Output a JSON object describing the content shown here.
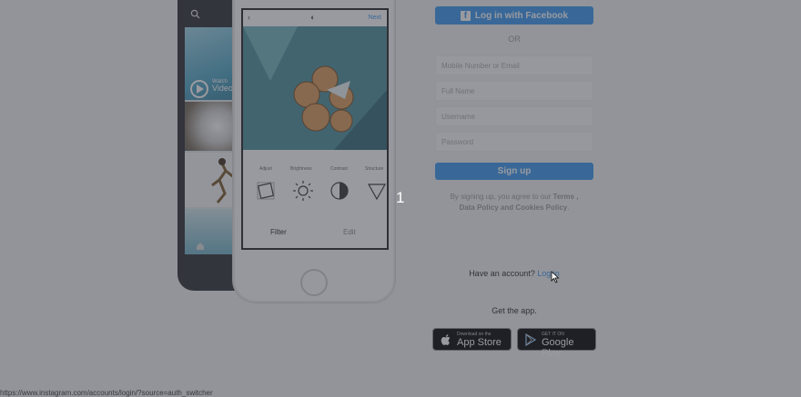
{
  "phone_back": {
    "video_text_1": "Watch",
    "video_text_2": "Video"
  },
  "phone_front": {
    "next_label": "Next",
    "tabs": [
      "Adjust",
      "Brightness",
      "Contrast",
      "Structure"
    ],
    "bottom_left": "Filter",
    "bottom_right": "Edit"
  },
  "step_number": "1",
  "form": {
    "facebook_label": "Log in with Facebook",
    "or_label": "OR",
    "mobile_placeholder": "Mobile Number or Email",
    "fullname_placeholder": "Full Name",
    "username_placeholder": "Username",
    "password_placeholder": "Password",
    "signup_label": "Sign up",
    "terms_prefix": "By signing up, you agree to our",
    "terms_links": "Terms , Data Policy and Cookies Policy",
    "terms_suffix": "."
  },
  "login_prompt": {
    "text": "Have an account?",
    "link": "Log in"
  },
  "get_app": "Get the app.",
  "stores": {
    "apple_small": "Download on the",
    "apple_big": "App Store",
    "google_small": "GET IT ON",
    "google_big": "Google Play"
  },
  "status_url": "https://www.instagram.com/accounts/login/?source=auth_switcher",
  "colors": {
    "accent": "#3897f0",
    "overlay": "#3c3e46"
  }
}
